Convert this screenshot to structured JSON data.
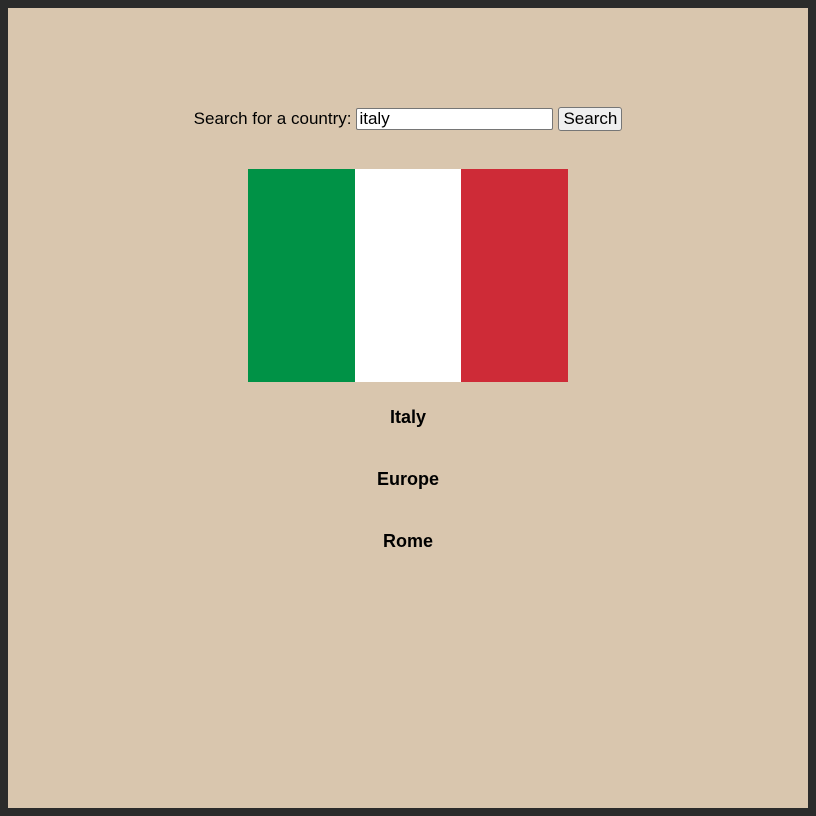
{
  "search": {
    "label": "Search for a country:",
    "value": "italy",
    "button_label": "Search"
  },
  "flag": {
    "stripes": [
      "#009246",
      "#ffffff",
      "#ce2b37"
    ]
  },
  "result": {
    "name": "Italy",
    "region": "Europe",
    "capital": "Rome"
  },
  "colors": {
    "background": "#d9c6ae",
    "outer_border": "#2b2b2b"
  }
}
